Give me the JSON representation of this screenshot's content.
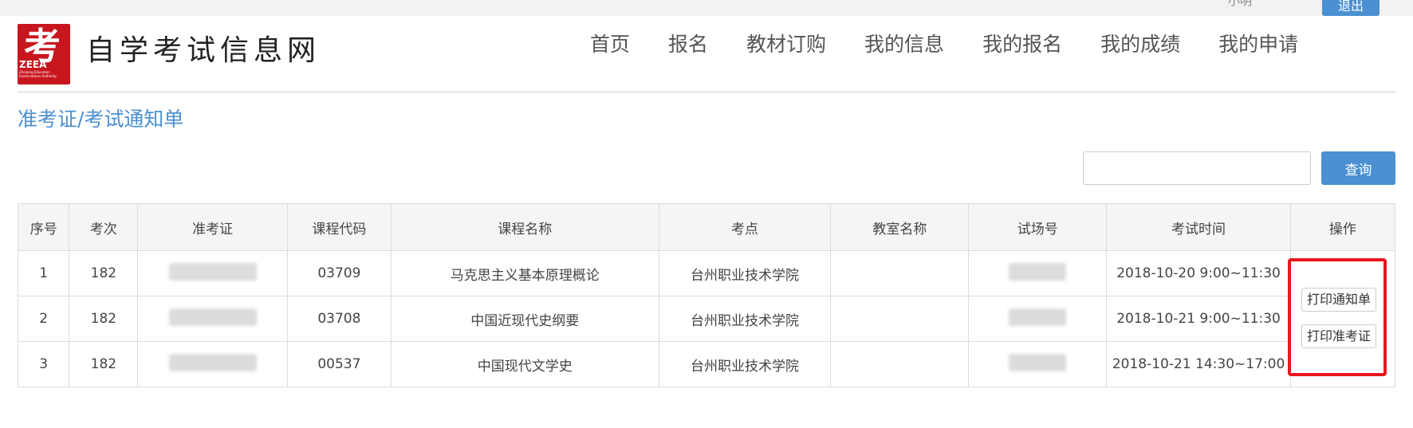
{
  "topbar": {
    "user_link": "小明",
    "logout_label": "退出"
  },
  "header": {
    "logo_char": "考",
    "logo_zeea": "ZEEA",
    "logo_en": "Zhejiang Education Examinations Authority",
    "site_name": "自学考试信息网"
  },
  "nav": [
    "首页",
    "报名",
    "教材订购",
    "我的信息",
    "我的报名",
    "我的成绩",
    "我的申请"
  ],
  "page_title": "准考证/考试通知单",
  "search": {
    "value": "",
    "button_label": "查询"
  },
  "table": {
    "headers": [
      "序号",
      "考次",
      "准考证",
      "课程代码",
      "课程名称",
      "考点",
      "教室名称",
      "试场号",
      "考试时间",
      "操作"
    ],
    "rows": [
      {
        "no": "1",
        "term": "182",
        "code": "03709",
        "course": "马克思主义基本原理概论",
        "site": "台州职业技术学院",
        "room": "",
        "time": "2018-10-20 9:00~11:30"
      },
      {
        "no": "2",
        "term": "182",
        "code": "03708",
        "course": "中国近现代史纲要",
        "site": "台州职业技术学院",
        "room": "",
        "time": "2018-10-21 9:00~11:30"
      },
      {
        "no": "3",
        "term": "182",
        "code": "00537",
        "course": "中国现代文学史",
        "site": "台州职业技术学院",
        "room": "",
        "time": "2018-10-21 14:30~17:00"
      }
    ]
  },
  "actions": {
    "print_notice": "打印通知单",
    "print_admission": "打印准考证"
  },
  "colors": {
    "accent": "#4a90d2",
    "highlight": "#e8161e",
    "brand_red": "#c8161e"
  }
}
